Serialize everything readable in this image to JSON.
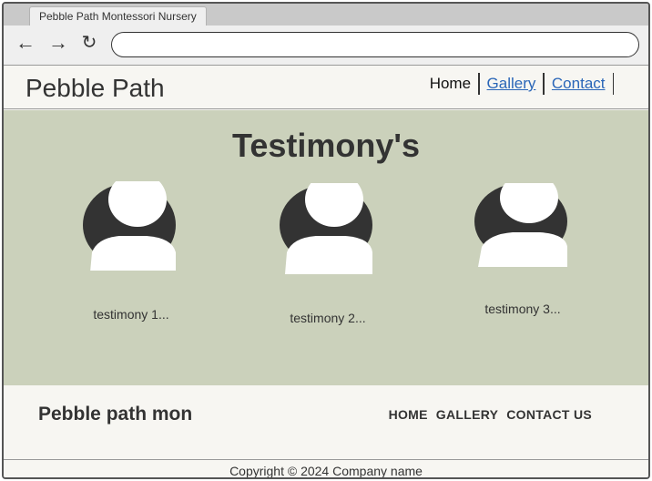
{
  "browser": {
    "tab_title": "Pebble Path Montessori Nursery",
    "address_value": "",
    "back_icon": "arrow-left-icon",
    "forward_icon": "arrow-right-icon",
    "reload_icon": "reload-icon"
  },
  "header": {
    "brand": "Pebble Path",
    "nav": [
      {
        "label": "Home",
        "current": true
      },
      {
        "label": "Gallery",
        "current": false
      },
      {
        "label": "Contact",
        "current": false
      }
    ]
  },
  "testimonials": {
    "title": "Testimony's",
    "items": [
      {
        "caption": "testimony 1...",
        "icon": "user-avatar-icon"
      },
      {
        "caption": "testimony 2...",
        "icon": "user-avatar-icon"
      },
      {
        "caption": "testimony 3...",
        "icon": "user-avatar-icon"
      }
    ]
  },
  "footer": {
    "brand": "Pebble path mon",
    "nav": [
      "HOME",
      "GALLERY",
      "CONTACT US"
    ],
    "copyright": "Copyright © 2024 Company name"
  },
  "colors": {
    "hero_bg": "#cbd1bb",
    "page_bg": "#f7f6f2",
    "link": "#2a66b8",
    "avatar_dark": "#333333"
  }
}
